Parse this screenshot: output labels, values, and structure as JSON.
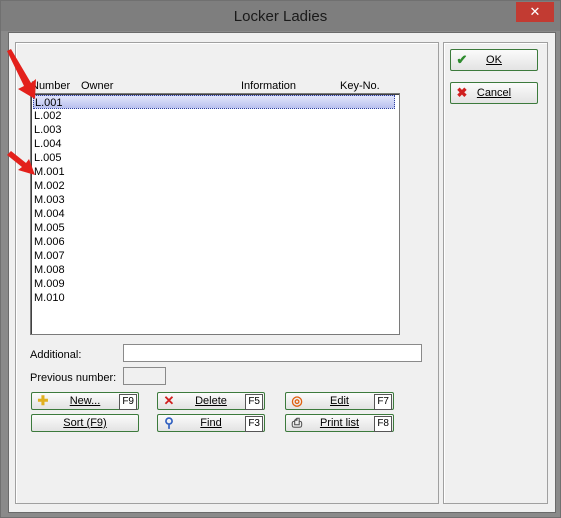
{
  "window": {
    "title": "Locker Ladies",
    "close_glyph": "✕"
  },
  "columns": [
    "Number",
    "Owner",
    "Information",
    "Key-No."
  ],
  "lockers": [
    "L.001",
    "L.002",
    "L.003",
    "L.004",
    "L.005",
    "M.001",
    "M.002",
    "M.003",
    "M.004",
    "M.005",
    "M.006",
    "M.007",
    "M.008",
    "M.009",
    "M.010"
  ],
  "selected_locker": "L.001",
  "fields": {
    "additional_label": "Additional:",
    "additional_value": "",
    "previous_label": "Previous number:",
    "previous_value": ""
  },
  "buttons": {
    "new": {
      "label": "New...",
      "key": "F9",
      "icon": "plus-icon"
    },
    "delete": {
      "label": "Delete",
      "key": "F5",
      "icon": "x-icon"
    },
    "edit": {
      "label": "Edit",
      "key": "F7",
      "icon": "ring-icon"
    },
    "sort": {
      "label": "Sort (F9)"
    },
    "find": {
      "label": "Find",
      "key": "F3",
      "icon": "magnifier-icon"
    },
    "print": {
      "label": "Print list",
      "key": "F8",
      "icon": "printer-icon"
    },
    "ok": {
      "label": "OK",
      "icon": "checkmark-icon"
    },
    "cancel": {
      "label": "Cancel",
      "icon": "x-icon"
    }
  },
  "colors": {
    "ok_green": "#2e8b2e",
    "cancel_red": "#d02020",
    "close_red": "#c23b32",
    "annotation_arrow": "#e3201b"
  }
}
